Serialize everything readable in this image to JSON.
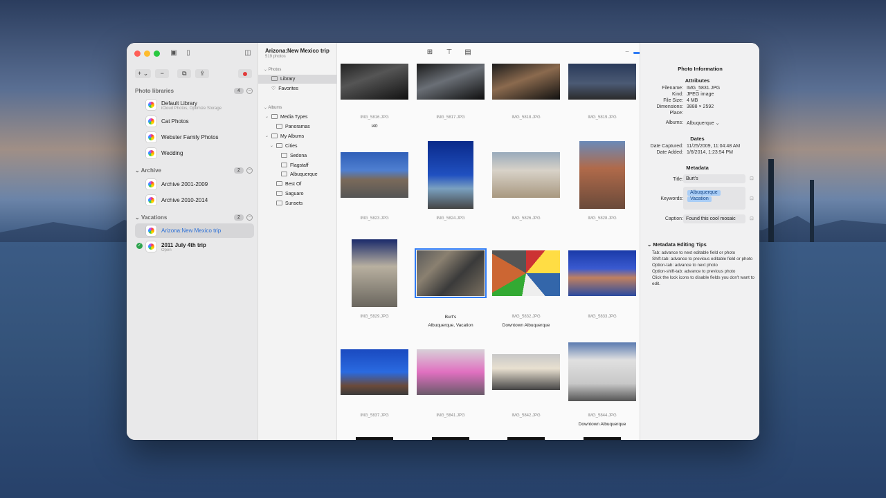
{
  "sidebar": {
    "sections": [
      {
        "title": "Photo libraries",
        "count": "4",
        "items": [
          {
            "name": "Default Library",
            "sub": "iCloud Photos, Optimize Storage"
          },
          {
            "name": "Cat Photos",
            "sub": ""
          },
          {
            "name": "Webster Family Photos",
            "sub": ""
          },
          {
            "name": "Wedding",
            "sub": ""
          }
        ]
      },
      {
        "title": "Archive",
        "count": "2",
        "items": [
          {
            "name": "Archive 2001-2009",
            "sub": ""
          },
          {
            "name": "Archive 2010-2014",
            "sub": ""
          }
        ]
      },
      {
        "title": "Vacations",
        "count": "2",
        "items": [
          {
            "name": "Arizona:New Mexico trip",
            "sub": ""
          },
          {
            "name": "2011 July 4th trip",
            "sub": "Open"
          }
        ]
      }
    ],
    "toolbar": {
      "add": "+ ⌄",
      "remove": "−"
    }
  },
  "albums": {
    "title": "Arizona:New Mexico trip",
    "subtitle": "519 photos",
    "photos_head": "Photos",
    "albums_head": "Albums",
    "items": {
      "library": "Library",
      "favorites": "Favorites",
      "media_types": "Media Types",
      "panoramas": "Panoramas",
      "my_albums": "My Albums",
      "cities": "Cities",
      "sedona": "Sedona",
      "flagstaff": "Flagstaff",
      "albuquerque": "Albuquerque",
      "best_of": "Best Of",
      "saguaro": "Saguaro",
      "sunsets": "Sunsets"
    }
  },
  "grid": {
    "photos": [
      {
        "file": "IMG_5816.JPG",
        "title": "I40",
        "kw": ""
      },
      {
        "file": "IMG_5817.JPG",
        "title": "",
        "kw": ""
      },
      {
        "file": "IMG_5818.JPG",
        "title": "",
        "kw": ""
      },
      {
        "file": "IMG_5819.JPG",
        "title": "",
        "kw": ""
      },
      {
        "file": "IMG_5823.JPG",
        "title": "",
        "kw": ""
      },
      {
        "file": "IMG_5824.JPG",
        "title": "",
        "kw": ""
      },
      {
        "file": "IMG_5826.JPG",
        "title": "",
        "kw": ""
      },
      {
        "file": "IMG_5828.JPG",
        "title": "",
        "kw": ""
      },
      {
        "file": "IMG_5829.JPG",
        "title": "",
        "kw": ""
      },
      {
        "file": "",
        "title": "Burt's",
        "kw": "Albuquerque, Vacation"
      },
      {
        "file": "IMG_5832.JPG",
        "title": "Downtown Albuquerque",
        "kw": ""
      },
      {
        "file": "IMG_5833.JPG",
        "title": "",
        "kw": ""
      },
      {
        "file": "IMG_5837.JPG",
        "title": "",
        "kw": ""
      },
      {
        "file": "IMG_5841.JPG",
        "title": "",
        "kw": ""
      },
      {
        "file": "IMG_5842.JPG",
        "title": "",
        "kw": ""
      },
      {
        "file": "IMG_5844.JPG",
        "title": "Downtown Albuquerque",
        "kw": ""
      }
    ],
    "zoom_fraction": 0.65
  },
  "inspector": {
    "title": "Photo Information",
    "attributes_head": "Attributes",
    "filename_lbl": "Filename:",
    "filename": "IMG_5831.JPG",
    "kind_lbl": "Kind:",
    "kind": "JPEG image",
    "size_lbl": "File Size:",
    "size": "4 MB",
    "dims_lbl": "Dimensions:",
    "dims": "3888 × 2592",
    "place_lbl": "Place:",
    "albums_lbl": "Albums:",
    "albums": "Albuquerque",
    "dates_head": "Dates",
    "captured_lbl": "Date Captured:",
    "captured": "11/25/2009, 11:04:48 AM",
    "added_lbl": "Date Added:",
    "added": "1/6/2014, 1:23:54 PM",
    "metadata_head": "Metadata",
    "title_lbl": "Title:",
    "title_val": "Burt's",
    "keywords_lbl": "Keywords:",
    "kw1": "Albuquerque",
    "kw2": "Vacation",
    "caption_lbl": "Caption:",
    "caption": "Found this cool mosaic",
    "tips_head": "Metadata Editing Tips",
    "tips": [
      "Tab: advance to next editable field or photo",
      "Shift-tab: advance to previous editable field or photo",
      "Option-tab: advance to next photo",
      "Option-shift-tab: advance to previous photo",
      "Click the lock icons to disable fields you don't want to edit."
    ]
  },
  "colors": {
    "accent": "#2f7bf5",
    "selected_text": "#2b6fd6"
  }
}
